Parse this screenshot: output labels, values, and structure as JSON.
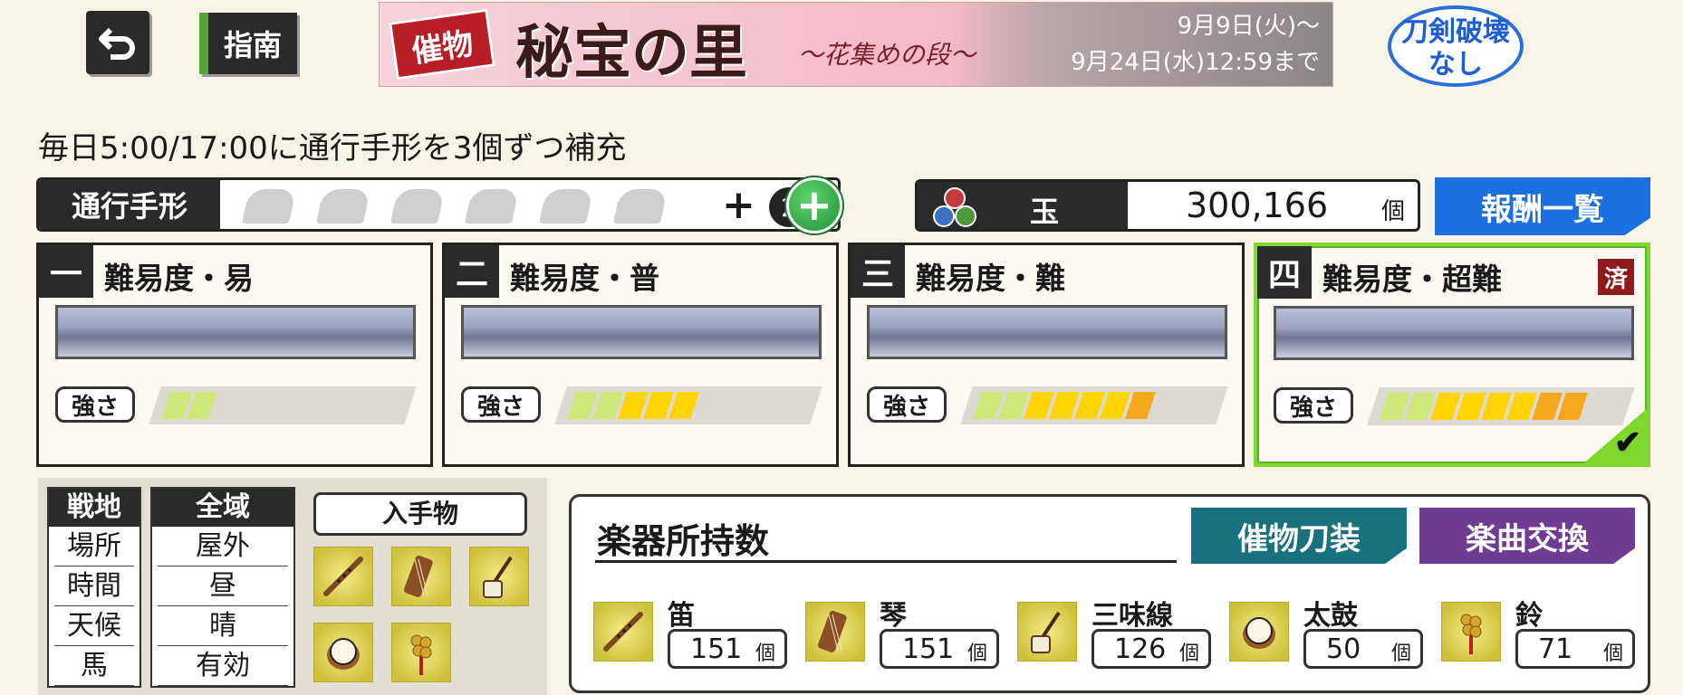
{
  "topbar": {
    "guide_label": "指南",
    "banner_tag": "催物",
    "banner_title": "秘宝の里",
    "banner_subtitle": "～花集めの段～",
    "banner_date_start": "9月9日(火)～",
    "banner_date_end": "9月24日(水)12:59まで",
    "no_break_line1": "刀剣破壊",
    "no_break_line2": "なし"
  },
  "notice": "毎日5:00/17:00に通行手形を3個ずつ補充",
  "pass": {
    "label": "通行手形",
    "slots": 6,
    "plus": "+",
    "extra_count": "2",
    "add_symbol": "+"
  },
  "gems": {
    "label": "玉",
    "value": "300,166",
    "unit": "個",
    "reward_button": "報酬一覧"
  },
  "difficulties": [
    {
      "num": "一",
      "title": "難易度・易",
      "strength_label": "強さ",
      "level": 2,
      "done": "",
      "selected": false
    },
    {
      "num": "二",
      "title": "難易度・普",
      "strength_label": "強さ",
      "level": 5,
      "done": "",
      "selected": false
    },
    {
      "num": "三",
      "title": "難易度・難",
      "strength_label": "強さ",
      "level": 7,
      "done": "",
      "selected": false
    },
    {
      "num": "四",
      "title": "難易度・超難",
      "strength_label": "強さ",
      "level": 8,
      "done": "済",
      "selected": true,
      "check": "✔"
    }
  ],
  "info": {
    "col1_head": "戦地",
    "col1_rows": [
      "場所",
      "時間",
      "天候",
      "馬"
    ],
    "col2_head": "全域",
    "col2_rows": [
      "屋外",
      "昼",
      "晴",
      "有効"
    ],
    "acquire_title": "入手物",
    "acquire_items": [
      "flute-icon",
      "koto-icon",
      "shamisen-icon",
      "drum-icon",
      "bell-icon"
    ]
  },
  "instruments": {
    "title": "楽器所持数",
    "event_button": "催物刀装",
    "exchange_button": "楽曲交換",
    "items": [
      {
        "name": "笛",
        "count": "151",
        "unit": "個",
        "icon": "flute-icon"
      },
      {
        "name": "琴",
        "count": "151",
        "unit": "個",
        "icon": "koto-icon"
      },
      {
        "name": "三味線",
        "count": "126",
        "unit": "個",
        "icon": "shamisen-icon"
      },
      {
        "name": "太鼓",
        "count": "50",
        "unit": "個",
        "icon": "drum-icon"
      },
      {
        "name": "鈴",
        "count": "71",
        "unit": "個",
        "icon": "bell-icon"
      }
    ]
  },
  "colors": {
    "seg_light": "#cfe87a",
    "seg_yellow": "#ffd400",
    "seg_orange": "#f4a81b",
    "selected_border": "#7fd72d"
  }
}
